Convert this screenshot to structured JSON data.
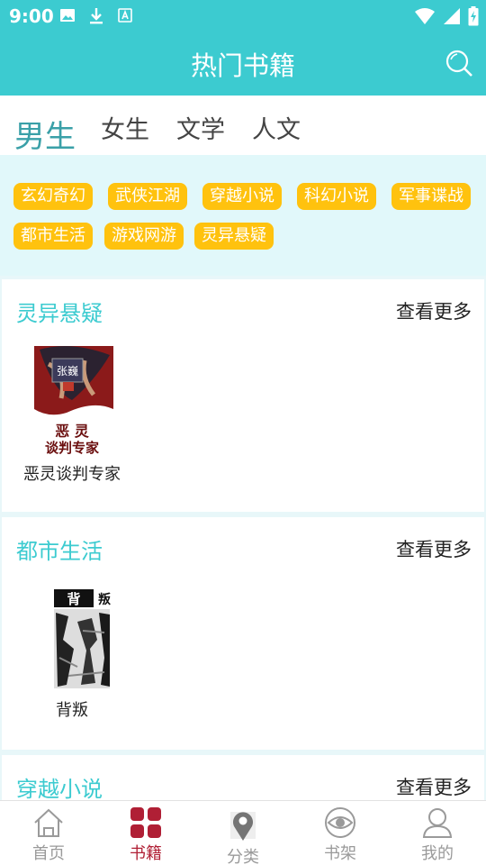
{
  "status": {
    "time": "9:00",
    "left_icons": [
      "image-icon",
      "download-icon",
      "font-icon"
    ],
    "right_icons": [
      "wifi-icon",
      "signal-icon",
      "battery-icon"
    ]
  },
  "header": {
    "title": "热门书籍",
    "search_icon": "search-icon"
  },
  "colors": {
    "accent": "#3ccbd0",
    "tag": "#ffc20e",
    "nav_active": "#b01f35",
    "nav_inactive": "#9a9a9a"
  },
  "tabs": [
    {
      "label": "男生",
      "active": true
    },
    {
      "label": "女生",
      "active": false
    },
    {
      "label": "文学",
      "active": false
    },
    {
      "label": "人文",
      "active": false
    }
  ],
  "tags": [
    "玄幻奇幻",
    "武侠江湖",
    "穿越小说",
    "科幻小说",
    "军事谍战",
    "都市生活",
    "游戏网游",
    "灵异悬疑"
  ],
  "sections": [
    {
      "title": "灵异悬疑",
      "more": "查看更多",
      "books": [
        {
          "name": "恶灵谈判专家",
          "cover_text": "恶 灵\n谈判专家",
          "cover_badge": "张巍"
        }
      ]
    },
    {
      "title": "都市生活",
      "more": "查看更多",
      "books": [
        {
          "name": "背叛",
          "cover_text": "背",
          "cover_side": "叛"
        }
      ]
    },
    {
      "title": "穿越小说",
      "more": "查看更多",
      "books": []
    }
  ],
  "nav": [
    {
      "label": "首页",
      "icon": "home-icon",
      "active": false
    },
    {
      "label": "书籍",
      "icon": "books-grid-icon",
      "active": true
    },
    {
      "label": "分类",
      "icon": "location-pin-icon",
      "active": false
    },
    {
      "label": "书架",
      "icon": "eye-icon",
      "active": false
    },
    {
      "label": "我的",
      "icon": "user-icon",
      "active": false
    }
  ]
}
